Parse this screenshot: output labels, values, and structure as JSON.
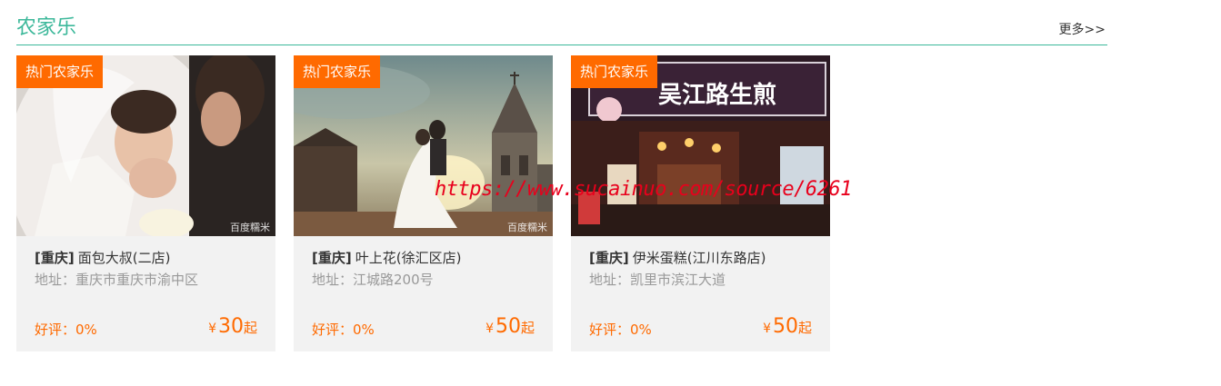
{
  "section": {
    "title": "农家乐",
    "more_label": "更多>>"
  },
  "cards": [
    {
      "badge": "热门农家乐",
      "photo_watermark": "百度糯米",
      "region": "[重庆]",
      "name": "面包大叔(二店)",
      "address": "地址：重庆市重庆市渝中区",
      "rating": "好评：0%",
      "currency": "¥",
      "price": "30",
      "price_suffix": "起"
    },
    {
      "badge": "热门农家乐",
      "photo_watermark": "百度糯米",
      "region": "[重庆]",
      "name": "叶上花(徐汇区店)",
      "address": "地址：江城路200号",
      "rating": "好评：0%",
      "currency": "¥",
      "price": "50",
      "price_suffix": "起"
    },
    {
      "badge": "热门农家乐",
      "photo_sign": "吴江路生煎",
      "region": "[重庆]",
      "name": "伊米蛋糕(江川东路店)",
      "address": "地址：凯里市滨江大道",
      "rating": "好评：0%",
      "currency": "¥",
      "price": "50",
      "price_suffix": "起"
    }
  ],
  "overlay_url": "https://www.sucainuo.com/source/6261",
  "colors": {
    "accent": "#3cb89a",
    "badge": "#ff6a00",
    "price": "#ff6a00",
    "card_bg": "#f2f2f2",
    "watermark_url": "#e8001c"
  }
}
